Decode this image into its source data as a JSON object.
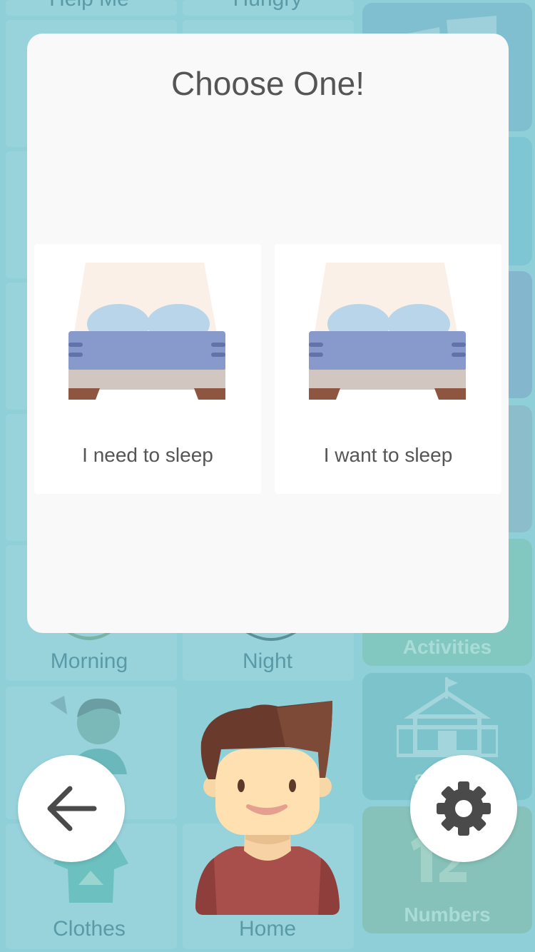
{
  "modal": {
    "title": "Choose One!",
    "choices": [
      {
        "label": "I need to sleep",
        "icon": "bed-icon"
      },
      {
        "label": "I want to sleep",
        "icon": "bed-icon"
      }
    ]
  },
  "background_grid": {
    "top_partial_labels": [
      "Help Me",
      "Hungry"
    ],
    "tiles": [
      {
        "label": "Morning"
      },
      {
        "label": "Night"
      },
      {
        "label": "Clothes"
      },
      {
        "label": "Home"
      }
    ]
  },
  "categories": [
    {
      "label": "Activities"
    },
    {
      "label": "School"
    },
    {
      "label": "Numbers"
    }
  ],
  "buttons": {
    "back_icon": "arrow-left-icon",
    "settings_icon": "gear-icon"
  },
  "colors": {
    "background": "#8fcfd8",
    "modal": "#f9f9f9",
    "text": "#555555"
  }
}
